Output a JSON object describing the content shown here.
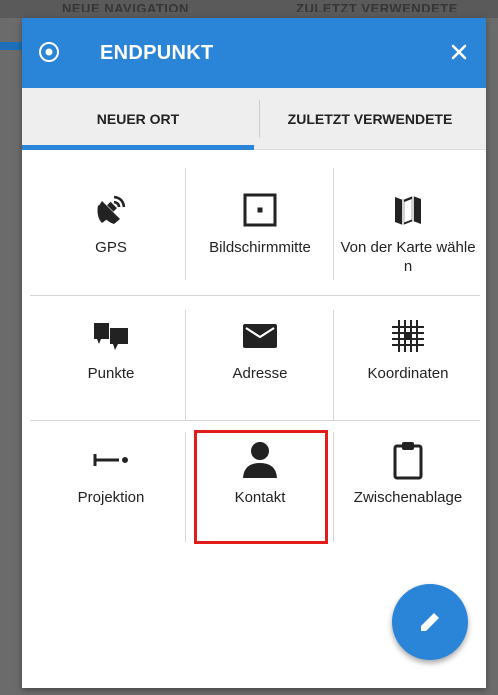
{
  "backdrop": {
    "peek_left": "NEUE NAVIGATION",
    "peek_right": "ZULETZT VERWENDETE"
  },
  "header": {
    "title": "ENDPUNKT",
    "icon": "target-icon",
    "close_icon": "close-icon"
  },
  "tabs": [
    {
      "label": "NEUER ORT",
      "active": true
    },
    {
      "label": "ZULETZT VERWENDETE",
      "active": false
    }
  ],
  "grid": {
    "items": [
      {
        "label": "GPS",
        "icon": "gps-satellite-icon"
      },
      {
        "label": "Bildschirmmitte",
        "icon": "screen-center-icon"
      },
      {
        "label": "Von der Karte wählen",
        "icon": "map-icon"
      },
      {
        "label": "Punkte",
        "icon": "points-icon"
      },
      {
        "label": "Adresse",
        "icon": "envelope-icon"
      },
      {
        "label": "Koordinaten",
        "icon": "grid-coordinates-icon"
      },
      {
        "label": "Projektion",
        "icon": "projection-icon"
      },
      {
        "label": "Kontakt",
        "icon": "contact-icon"
      },
      {
        "label": "Zwischenablage",
        "icon": "clipboard-icon"
      }
    ]
  },
  "fab": {
    "icon": "pencil-icon"
  },
  "colors": {
    "accent": "#2a84d8",
    "highlight": "#e21b1b"
  }
}
